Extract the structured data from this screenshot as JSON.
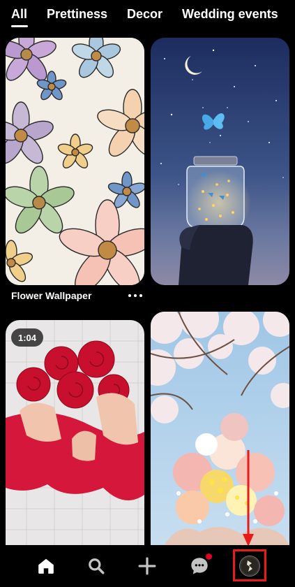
{
  "tabs": [
    {
      "label": "All",
      "active": true
    },
    {
      "label": "Prettiness",
      "active": false
    },
    {
      "label": "Decor",
      "active": false
    },
    {
      "label": "Wedding events",
      "active": false
    }
  ],
  "pins": [
    {
      "caption": "Flower Wallpaper",
      "image": "flower-wallpaper-illustration"
    },
    {
      "caption": "",
      "image": "butterfly-jar-night-sky"
    },
    {
      "caption": "",
      "image": "red-paper-roses-video",
      "duration": "1:04"
    },
    {
      "caption": "",
      "image": "cherry-blossom-bouquet"
    }
  ],
  "navbar": {
    "items": [
      {
        "name": "home",
        "icon": "home-icon",
        "active": true
      },
      {
        "name": "search",
        "icon": "search-icon"
      },
      {
        "name": "create",
        "icon": "plus-icon"
      },
      {
        "name": "messages",
        "icon": "chat-bubble-icon",
        "has_notification": true
      },
      {
        "name": "profile",
        "icon": "profile-avatar",
        "highlighted": true
      }
    ]
  },
  "colors": {
    "background": "#000000",
    "notification_badge": "#e60023",
    "annotation": "#e81a1a"
  }
}
